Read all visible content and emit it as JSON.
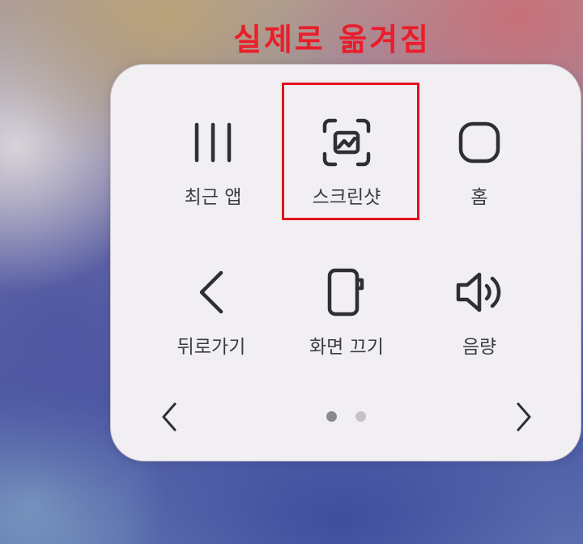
{
  "annotation": {
    "title": "실제로 옮겨짐",
    "color": "#ea1d2b"
  },
  "menu": {
    "items": [
      {
        "label": "최근 앱",
        "icon": "recent-apps-icon"
      },
      {
        "label": "스크린샷",
        "icon": "screenshot-icon"
      },
      {
        "label": "홈",
        "icon": "home-icon"
      },
      {
        "label": "뒤로가기",
        "icon": "back-icon"
      },
      {
        "label": "화면 끄기",
        "icon": "screen-off-icon"
      },
      {
        "label": "음량",
        "icon": "volume-icon"
      }
    ],
    "highlighted_item": "스크린샷"
  },
  "pagination": {
    "current_page": 1,
    "total_pages": 2,
    "prev_icon": "chevron-left-icon",
    "next_icon": "chevron-right-icon"
  },
  "colors": {
    "panel_bg": "#f2eff3",
    "icon_stroke": "#2f2f33",
    "label_text": "#3c3c3f",
    "dot_active": "#8a8890",
    "dot_inactive": "#c4c2c8",
    "highlight_border": "#e3121e"
  }
}
